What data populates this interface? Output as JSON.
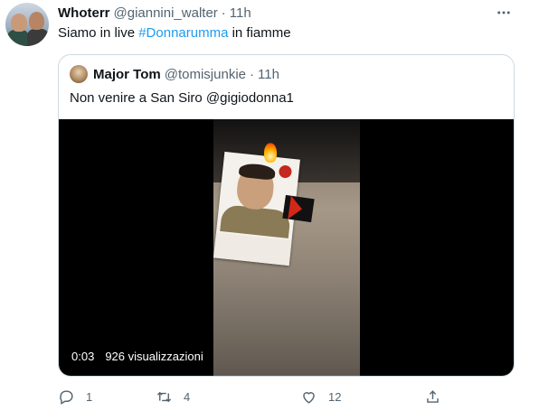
{
  "tweet": {
    "author_name": "Whoterr",
    "author_handle": "@giannini_walter",
    "separator": "·",
    "time": "11h",
    "text_before": "Siamo in live ",
    "hashtag": "#Donnarumma",
    "text_after": " in fiamme"
  },
  "quoted": {
    "author_name": "Major Tom",
    "author_handle": "@tomisjunkie",
    "separator": "·",
    "time": "11h",
    "text": "Non venire a San Siro @gigiodonna1",
    "video": {
      "duration": "0:03",
      "views": "926 visualizzazioni"
    }
  },
  "actions": {
    "reply_count": "1",
    "retweet_count": "4",
    "like_count": "12"
  },
  "colors": {
    "accent": "#1d9bf0",
    "secondary_text": "#536471",
    "border": "#cfd9de"
  },
  "icons": [
    "more-icon",
    "reply-icon",
    "retweet-icon",
    "like-icon",
    "share-icon"
  ]
}
